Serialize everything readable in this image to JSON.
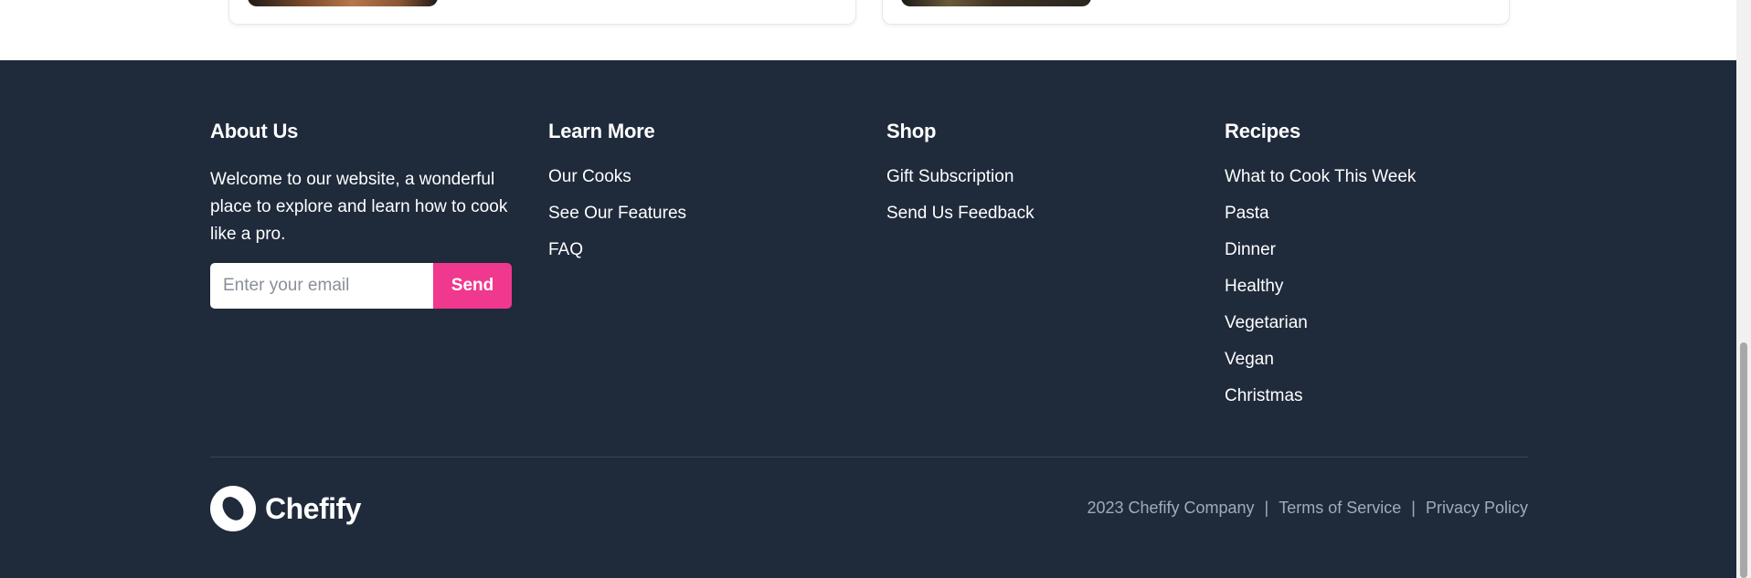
{
  "about": {
    "title": "About Us",
    "text": "Welcome to our website, a wonderful place to explore and learn how to cook like a pro.",
    "email_placeholder": "Enter your email",
    "send_label": "Send"
  },
  "learn_more": {
    "title": "Learn More",
    "links": [
      "Our Cooks",
      "See Our Features",
      "FAQ"
    ]
  },
  "shop": {
    "title": "Shop",
    "links": [
      "Gift Subscription",
      "Send Us Feedback"
    ]
  },
  "recipes": {
    "title": "Recipes",
    "links": [
      "What to Cook This Week",
      "Pasta",
      "Dinner",
      "Healthy",
      "Vegetarian",
      "Vegan",
      "Christmas"
    ]
  },
  "brand": {
    "name": "Chefify",
    "logo_icon": "chefify-logo-icon"
  },
  "legal": {
    "copyright": "2023 Chefify Company",
    "separator": "|",
    "terms": "Terms of Service",
    "privacy": "Privacy Policy"
  },
  "colors": {
    "footer_bg": "#1f2a3b",
    "accent": "#f0388f",
    "muted_text": "#a3abb8"
  }
}
